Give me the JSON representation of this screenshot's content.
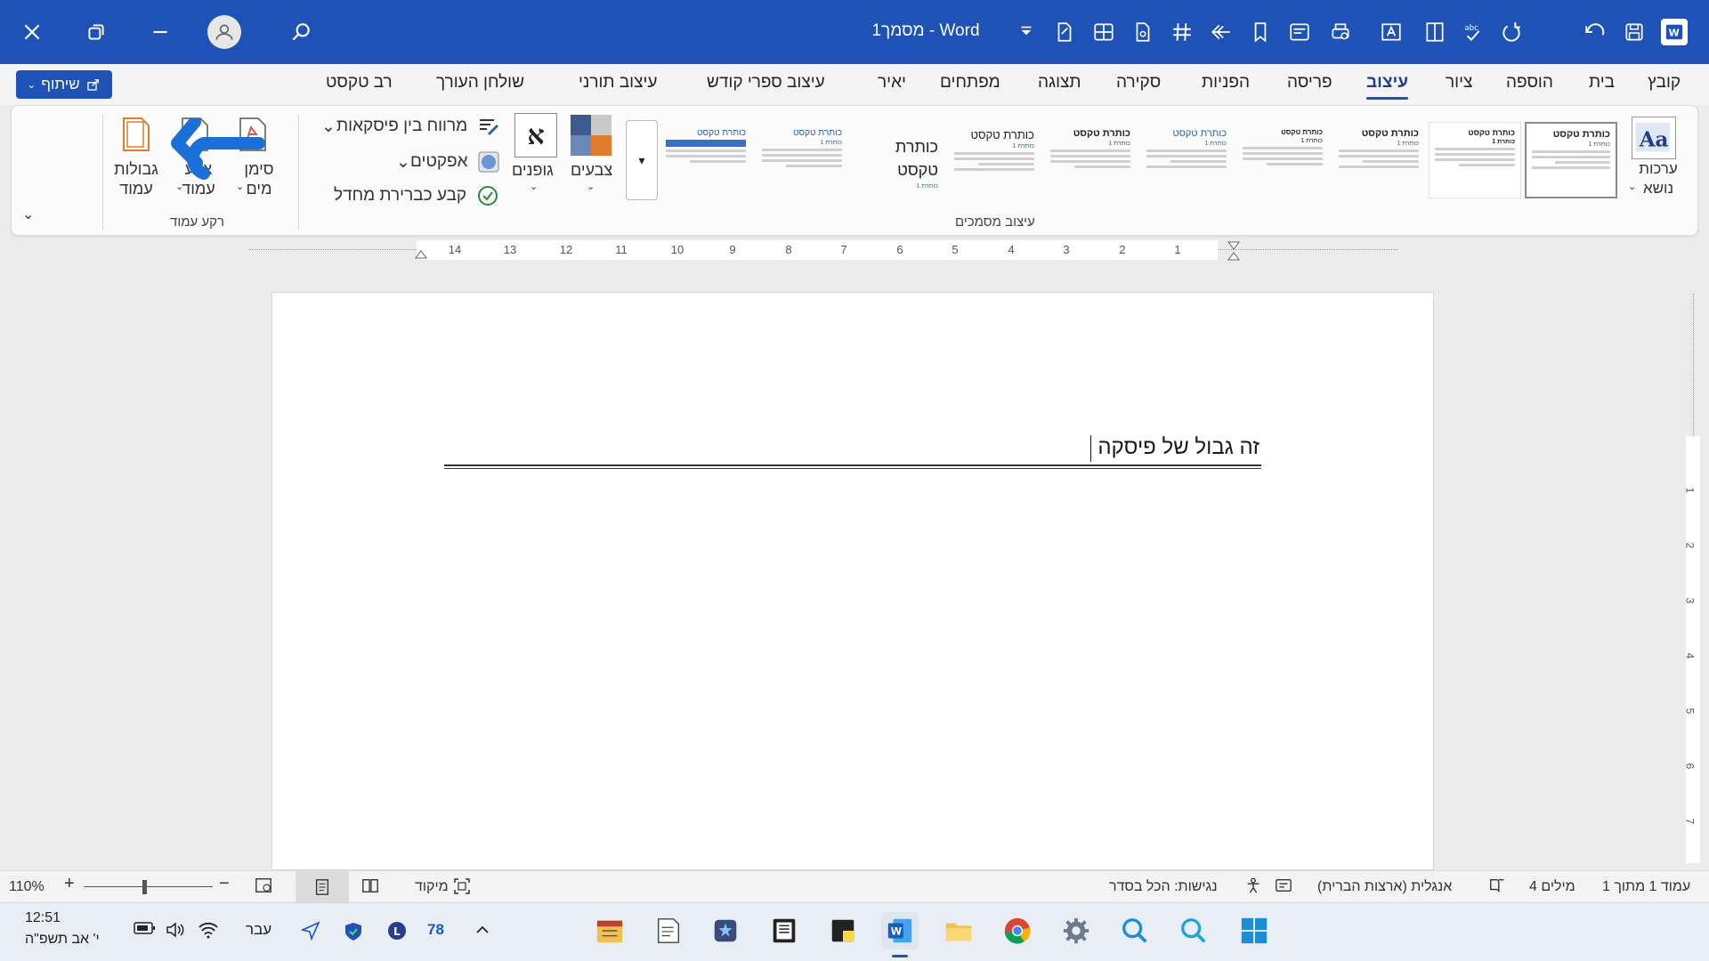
{
  "titlebar": {
    "doc_title": "מסמך1 - Word"
  },
  "tabs": [
    "קובץ",
    "בית",
    "הוספה",
    "ציור",
    "עיצוב",
    "פריסה",
    "הפניות",
    "סקירה",
    "תצוגה",
    "מפתחים",
    "יאיר",
    "עיצוב ספרי קודש",
    "עיצוב תורני",
    "שולחן העורך",
    "רב טקסט"
  ],
  "active_tab": "עיצוב",
  "share_button": "שיתוף",
  "ribbon": {
    "themes_label": "ערכות נושא",
    "doc_formatting_group": "עיצוב מסמכים",
    "style_thumb_title": "כותרת טקסט",
    "style_thumb_heading": "כותרת 1",
    "big_style_label": "כותרת טקסט",
    "colors_label": "צבעים",
    "fonts_label": "גופנים",
    "fonts_glyph": "א",
    "paragraph_spacing": "מרווח בין פיסקאות",
    "effects": "אפקטים",
    "set_default": "קבע כברירת מחדל",
    "watermark": "סימן מים",
    "page_color": "צבע עמוד",
    "page_borders": "גבולות עמוד",
    "page_background_group": "רקע עמוד"
  },
  "ruler": {
    "numbers": [
      "1",
      "2",
      "3",
      "4",
      "5",
      "6",
      "7",
      "8",
      "9",
      "10",
      "11",
      "12",
      "13",
      "14"
    ]
  },
  "vruler": {
    "numbers": [
      "1",
      "2",
      "3",
      "4",
      "5",
      "6",
      "7"
    ]
  },
  "document": {
    "text": "זה גבול של פיסקה"
  },
  "statusbar": {
    "page": "עמוד 1 מתוך 1",
    "words": "4 מילים",
    "language": "אנגלית (ארצות הברית)",
    "accessibility": "נגישות: הכל בסדר",
    "focus": "מיקוד",
    "zoom": "110%"
  },
  "taskbar": {
    "time": "12:51",
    "date": "י' אב תשפ\"ה",
    "lang": "עבר",
    "badge": "78"
  },
  "colors": {
    "title_blue": "#1f52b6",
    "page": "#ffffff",
    "background": "#ececec"
  }
}
